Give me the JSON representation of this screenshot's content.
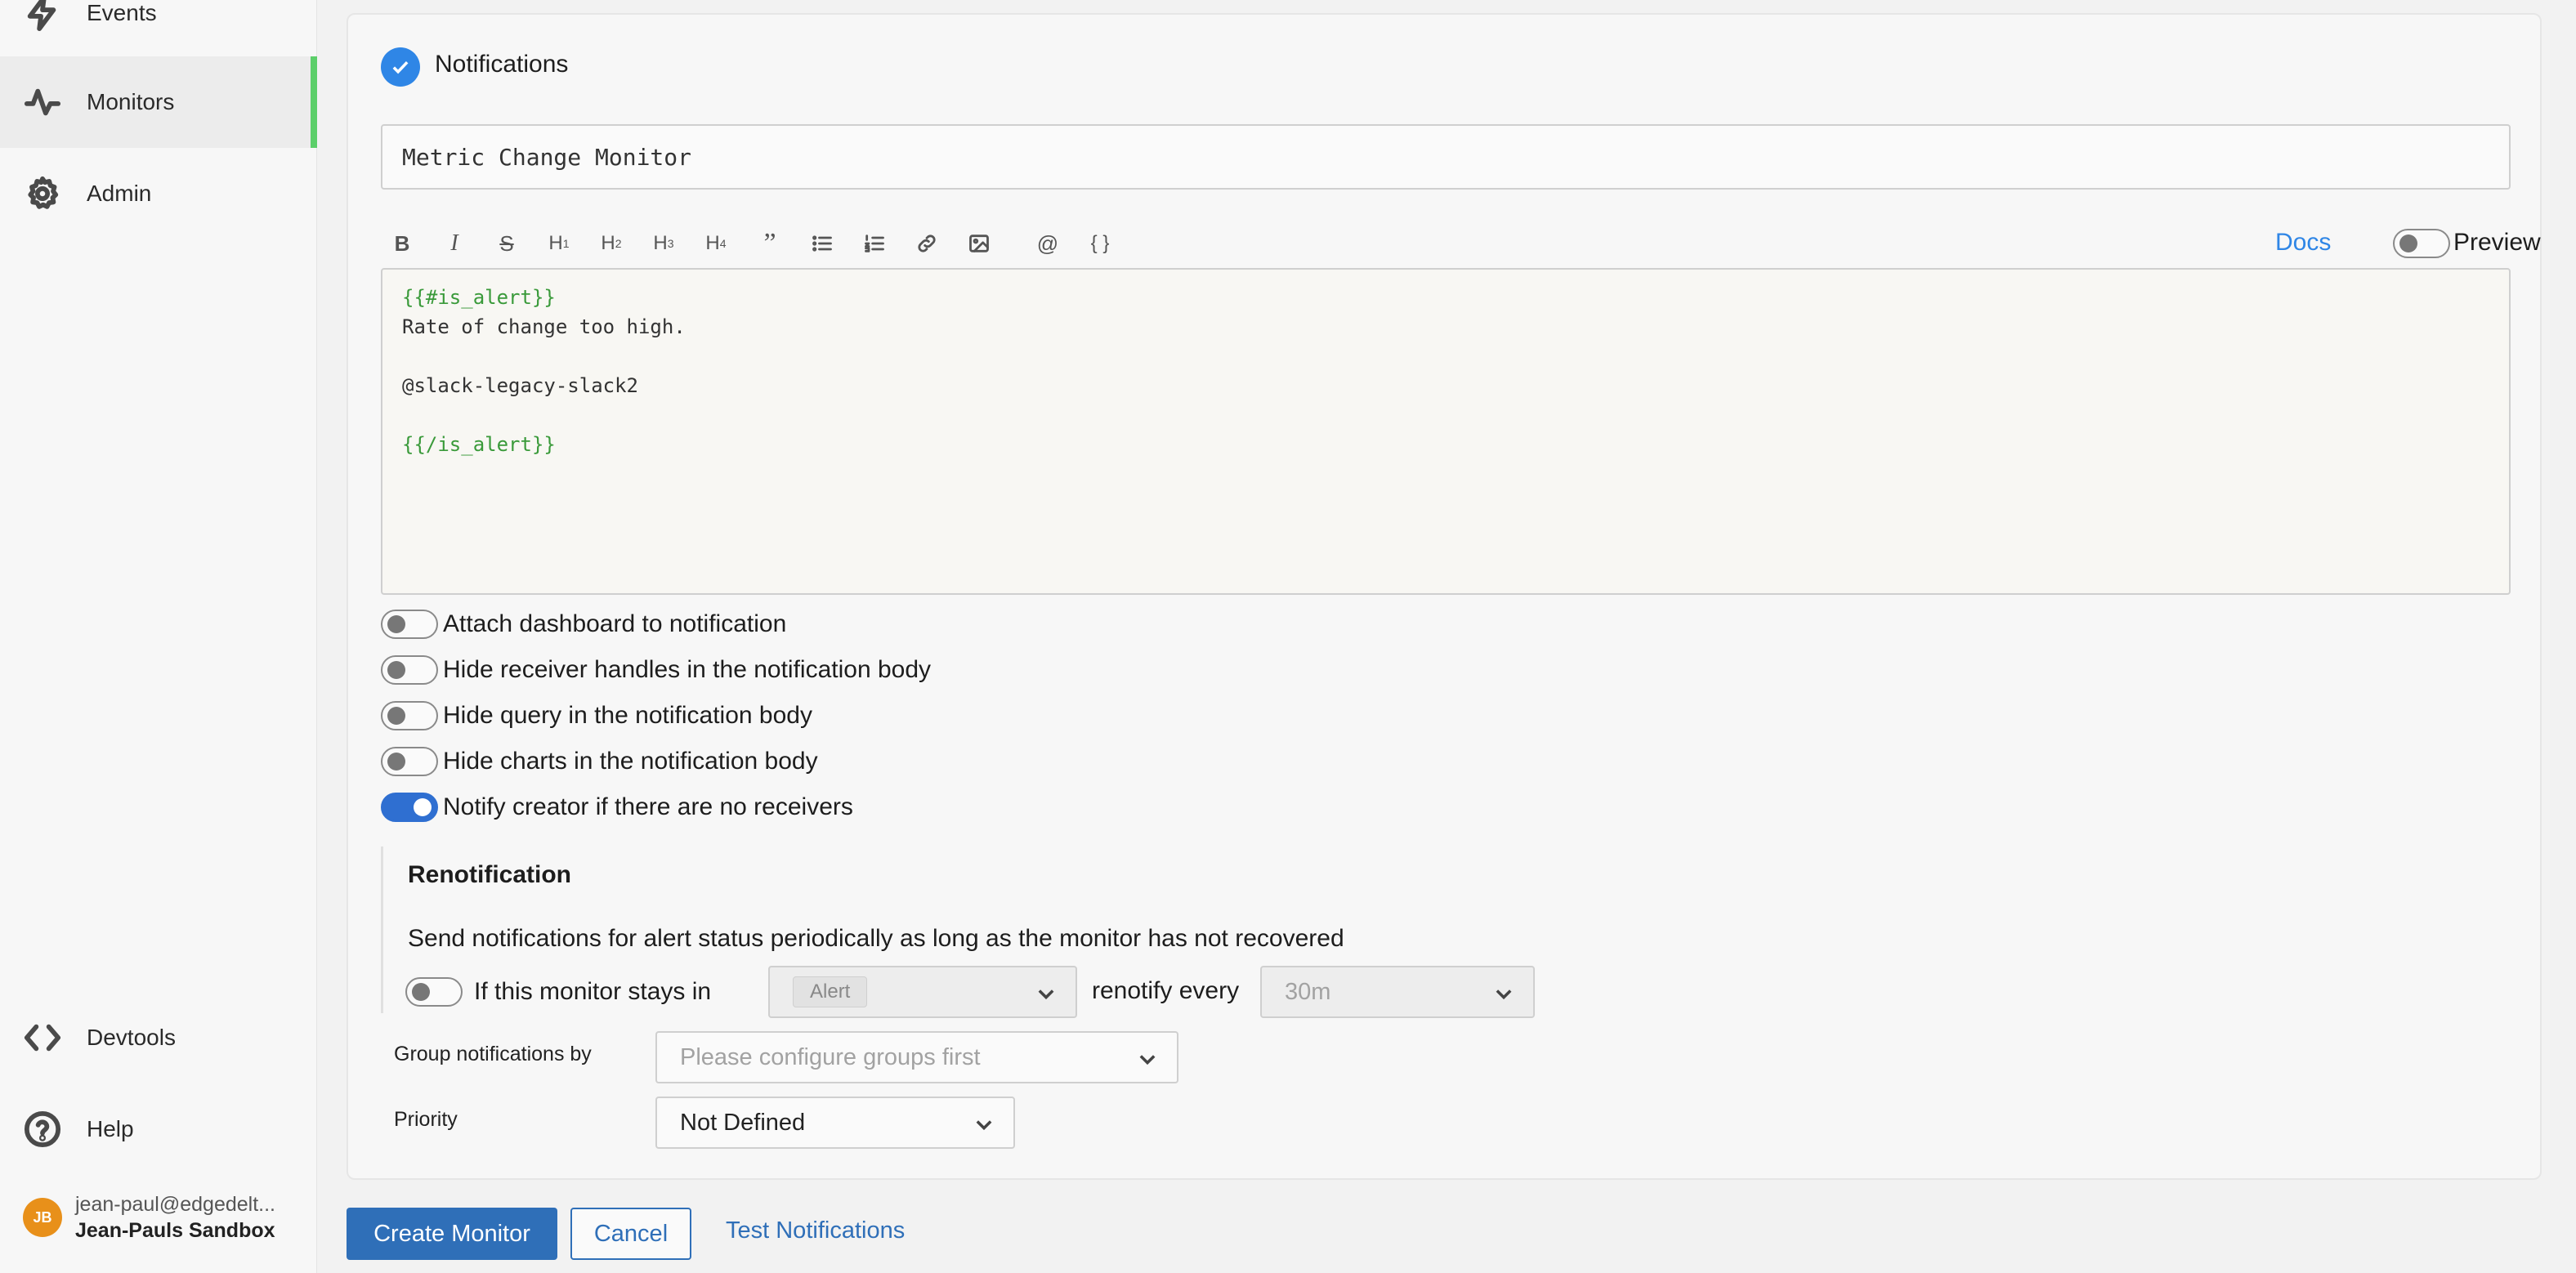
{
  "sidebar": {
    "items": [
      {
        "label": "Events",
        "icon": "lightning-icon"
      },
      {
        "label": "Monitors",
        "icon": "activity-icon",
        "active": true
      },
      {
        "label": "Admin",
        "icon": "gear-icon"
      },
      {
        "label": "Devtools",
        "icon": "code-icon"
      },
      {
        "label": "Help",
        "icon": "help-icon"
      }
    ],
    "user": {
      "initials": "JB",
      "email": "jean-paul@edgedelt...",
      "org": "Jean-Pauls Sandbox"
    }
  },
  "notifications": {
    "section_title": "Notifications",
    "title_value": "Metric Change Monitor",
    "toolbar": {
      "buttons": [
        "B",
        "I",
        "S",
        "H1",
        "H2",
        "H3",
        "H4",
        "quote",
        "bulleted-list",
        "numbered-list",
        "link",
        "image",
        "@",
        "{ }"
      ],
      "docs_label": "Docs",
      "preview_label": "Preview",
      "preview_on": false
    },
    "editor_lines": [
      "{{#is_alert}}",
      "Rate of change too high.",
      "",
      "@slack-legacy-slack2",
      "",
      "{{/is_alert}}"
    ],
    "options": [
      {
        "label": "Attach dashboard to notification",
        "on": false
      },
      {
        "label": "Hide receiver handles in the notification body",
        "on": false
      },
      {
        "label": "Hide query in the notification body",
        "on": false
      },
      {
        "label": "Hide charts in the notification body",
        "on": false
      },
      {
        "label": "Notify creator if there are no receivers",
        "on": true
      }
    ],
    "renotification": {
      "title": "Renotification",
      "description": "Send notifications for alert status periodically as long as the monitor has not recovered",
      "stays_in_label": "If this monitor stays in",
      "status_value": "Alert",
      "renotify_label": "renotify every",
      "interval_value": "30m",
      "enabled": false
    },
    "group_by": {
      "label": "Group notifications by",
      "placeholder": "Please configure groups first"
    },
    "priority": {
      "label": "Priority",
      "value": "Not Defined"
    }
  },
  "actions": {
    "create_label": "Create Monitor",
    "cancel_label": "Cancel",
    "test_label": "Test Notifications"
  },
  "colors": {
    "accent": "#2f86e6",
    "active_nav": "#5ccf6a",
    "primary_button": "#2f6fb8",
    "template_tag": "#3a9a3a"
  }
}
